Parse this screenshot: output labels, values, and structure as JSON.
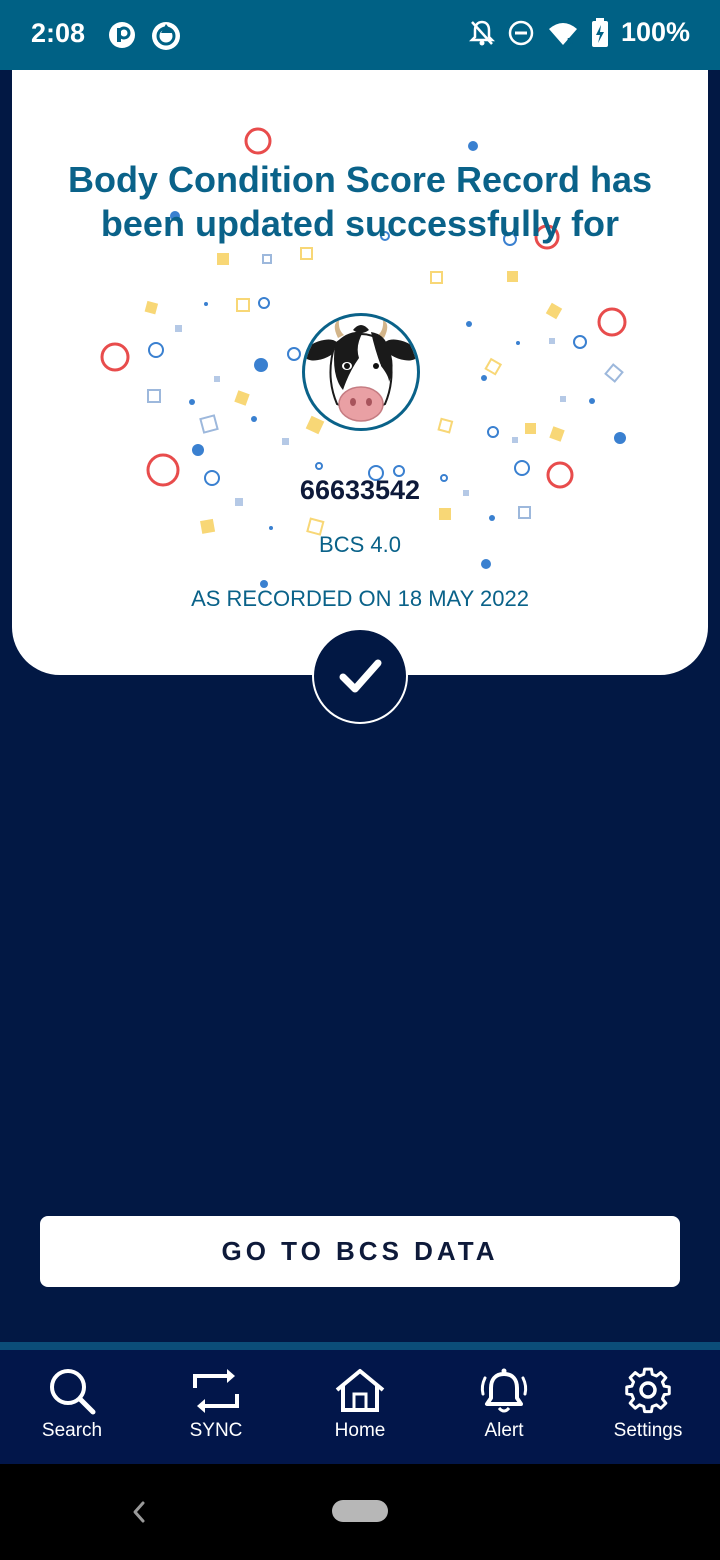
{
  "status_bar": {
    "time": "2:08",
    "battery": "100%",
    "icons": [
      "app-p-icon",
      "app-ring-icon",
      "notifications-off-icon",
      "do-not-disturb-icon",
      "wifi-icon",
      "battery-charging-icon"
    ]
  },
  "card": {
    "title": "Body Condition Score Record has been updated successfully for",
    "animal_id": "66633542",
    "bcs": "BCS 4.0",
    "recorded": "AS RECORDED ON 18 MAY 2022"
  },
  "actions": {
    "primary_label": "GO TO BCS DATA"
  },
  "bottom_nav": {
    "items": [
      {
        "label": "Search",
        "icon": "search-icon"
      },
      {
        "label": "SYNC",
        "icon": "sync-icon"
      },
      {
        "label": "Home",
        "icon": "home-icon"
      },
      {
        "label": "Alert",
        "icon": "bell-icon"
      },
      {
        "label": "Settings",
        "icon": "gear-icon"
      }
    ]
  },
  "colors": {
    "background": "#021844",
    "status_bar": "#006185",
    "accent": "#0a6289"
  }
}
